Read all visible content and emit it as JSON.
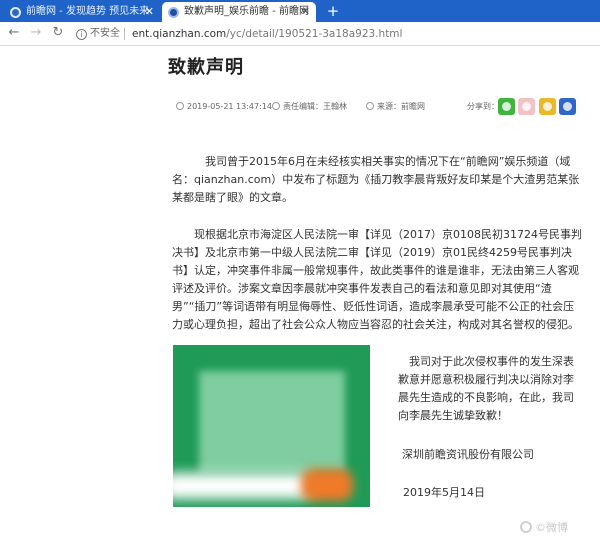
{
  "browser": {
    "tabs": [
      {
        "title": "前瞻网 - 发现趋势 预见未来",
        "active": false
      },
      {
        "title": "致歉声明_娱乐前瞻 - 前瞻网",
        "active": true
      }
    ],
    "new_tab": "+",
    "security_label": "不安全",
    "url_host": "ent.qianzhan.com",
    "url_path": "/yc/detail/190521-3a18a923.html"
  },
  "article": {
    "title": "致歉声明",
    "datetime": "2019-05-21 13:47:14",
    "editor": "责任编辑：王翰林",
    "source": "来源：前瞻网",
    "share_label": "分享到：",
    "paragraphs": [
      "我司曾于2015年6月在未经核实相关事实的情况下在“前瞻网”娱乐频道（域名：qianzhan.com）中发布了标题为《插刀教李晨背叛好友印某是个大渣男范某张某都是瞎了眼》的文章。",
      "现根据北京市海淀区人民法院一审【详见（2017）京0108民初31724号民事判决书】及北京市第一中级人民法院二审【详见（2019）京01民终4259号民事判决书】认定，冲突事件非属一般常规事件，故此类事件的谁是谁非，无法由第三人客观评述及评价。涉案文章因李晨就冲突事件发表自己的看法和意见即对其使用“渣男”“插刀”等词语带有明显侮辱性、贬低性词语，造成李晨承受可能不公正的社会压力或心理负担，超出了社会公众人物应当容忍的社会关注，构成对其名誉权的侵犯。",
      "我司对于此次侵权事件的发生深表歉意并愿意积极履行判决以消除对李晨先生造成的不良影响，在此，我司向李晨先生诚挚致歉！"
    ],
    "company": "深圳前瞻资讯股份有限公司",
    "date": "2019年5月14日"
  },
  "watermark": "©微博",
  "colors": {
    "tab_bar": "#1f63c9",
    "photo_green": "#1f9b57",
    "photo_orange": "#ef7a2a"
  }
}
